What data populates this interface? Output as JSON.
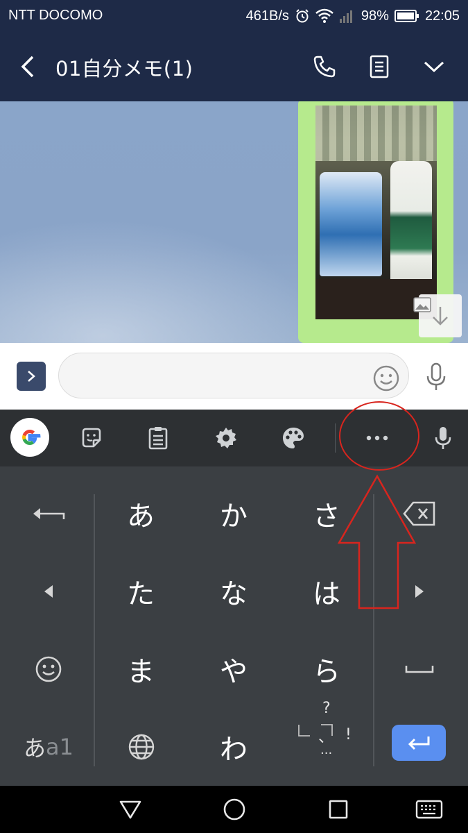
{
  "status_bar": {
    "carrier": "NTT DOCOMO",
    "network_speed": "461B/s",
    "battery": "98%",
    "time": "22:05",
    "icons": [
      "alarm-icon",
      "wifi-icon",
      "signal-icon",
      "battery-icon"
    ]
  },
  "header": {
    "title": "01自分メモ(1)",
    "icons": [
      "back-chevron-icon",
      "phone-icon",
      "notes-icon",
      "chevron-down-icon"
    ]
  },
  "chat": {
    "message_type": "image",
    "icons": [
      "image-icon",
      "download-icon"
    ]
  },
  "input_bar": {
    "message_value": "",
    "message_placeholder": "",
    "icons": [
      "expand-icon",
      "emoji-icon",
      "mic-icon"
    ]
  },
  "keyboard_toolbar": {
    "icons": [
      "google-icon",
      "sticker-icon",
      "clipboard-icon",
      "settings-icon",
      "theme-icon",
      "more-icon",
      "mic-icon"
    ]
  },
  "keyboard": {
    "keys": {
      "a": "あ",
      "ka": "か",
      "sa": "さ",
      "ta": "た",
      "na": "な",
      "ha": "は",
      "ma": "ま",
      "ya": "や",
      "ra": "ら",
      "wa": "わ"
    },
    "mode_label_primary": "あ",
    "mode_label_secondary": "a1",
    "punct": {
      "question": "?",
      "comma": "、",
      "excl": "!",
      "dots": "..."
    },
    "icons": [
      "undo-icon",
      "backspace-icon",
      "arrow-left-icon",
      "arrow-right-icon",
      "emoji-icon",
      "space-icon",
      "globe-icon",
      "enter-icon"
    ]
  },
  "annotation": {
    "color": "#d8251e"
  },
  "nav_bar": {
    "icons": [
      "back-triangle-icon",
      "home-circle-icon",
      "recents-square-icon",
      "keyboard-icon"
    ]
  },
  "colors": {
    "header_bg": "#1e2a47",
    "chat_bg": "#8aa5c9",
    "bubble_green": "#b6ea8d",
    "keyboard_bg": "#3b3f43",
    "enter_blue": "#5a8ff0"
  }
}
